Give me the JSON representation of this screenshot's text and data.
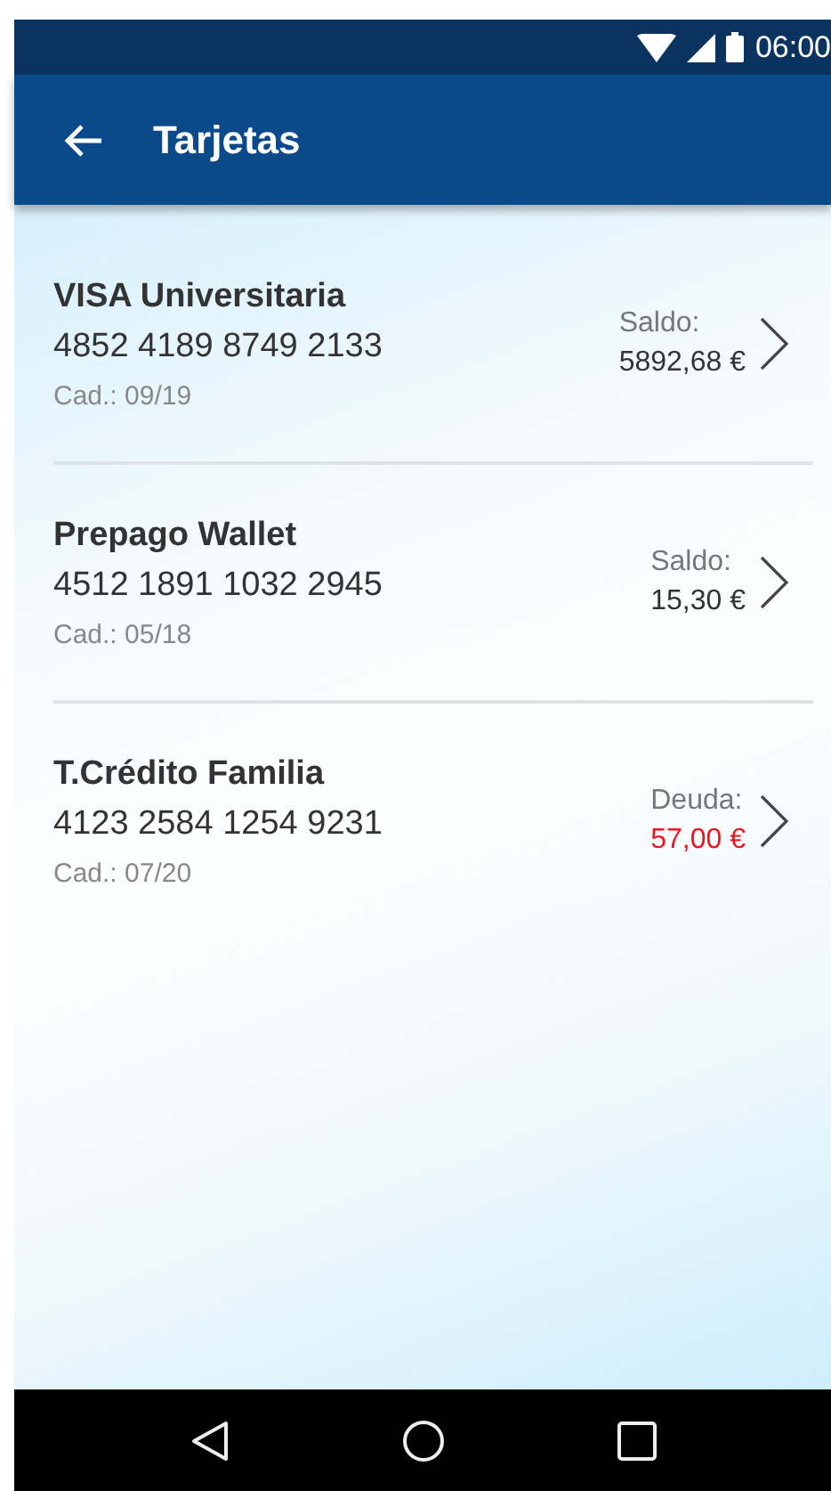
{
  "status_bar": {
    "time": "06:00"
  },
  "app_bar": {
    "title": "Tarjetas"
  },
  "cards": [
    {
      "name": "VISA Universitaria",
      "number": "4852 4189 8749 2133",
      "expiry": "Cad.: 09/19",
      "amount_label": "Saldo:",
      "amount": "5892,68 €",
      "kind": "balance"
    },
    {
      "name": "Prepago Wallet",
      "number": "4512 1891 1032 2945",
      "expiry": "Cad.: 05/18",
      "amount_label": "Saldo:",
      "amount": "15,30 €",
      "kind": "balance"
    },
    {
      "name": "T.Crédito Familia",
      "number": "4123 2584 1254 9231",
      "expiry": "Cad.: 07/20",
      "amount_label": "Deuda:",
      "amount": "57,00 €",
      "kind": "debt"
    }
  ]
}
